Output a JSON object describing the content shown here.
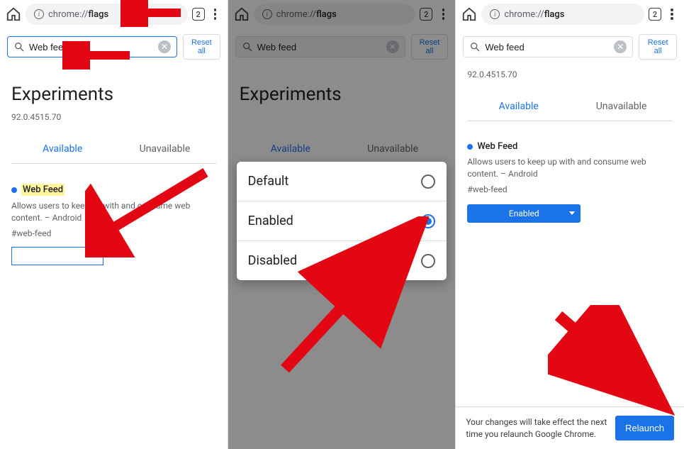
{
  "url": {
    "prefix": "chrome://",
    "bolded": "flags"
  },
  "tabs_count": "2",
  "search": {
    "value": "Web feed"
  },
  "reset_label": "Reset all",
  "heading": "Experiments",
  "version": "92.0.4515.70",
  "tab_labels": {
    "available": "Available",
    "unavailable": "Unavailable"
  },
  "flag": {
    "title": "Web Feed",
    "description": "Allows users to keep up with and consume web content. – Android",
    "tag": "#web-feed"
  },
  "popup": {
    "opt_default": "Default",
    "opt_enabled": "Enabled",
    "opt_disabled": "Disabled"
  },
  "enabled_label": "Enabled",
  "relaunch": {
    "message": "Your changes will take effect the next time you relaunch Google Chrome.",
    "button": "Relaunch"
  }
}
